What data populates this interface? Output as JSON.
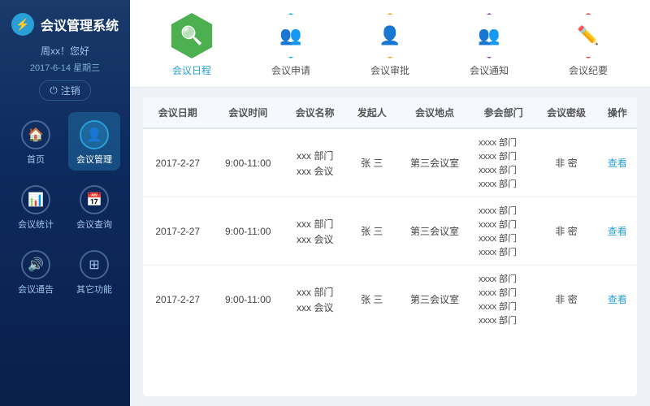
{
  "sidebar": {
    "logo_label": "会议管理系统",
    "user_greeting": "周xx！您好",
    "date": "2017-6-14  星期三",
    "logout_label": "注销",
    "nav_items": [
      {
        "id": "home",
        "label": "首页",
        "icon": "🏠",
        "active": false
      },
      {
        "id": "meeting-mgmt",
        "label": "会议管理",
        "icon": "👤",
        "active": true
      },
      {
        "id": "meeting-stats",
        "label": "会议统计",
        "icon": "📊",
        "active": false
      },
      {
        "id": "meeting-query",
        "label": "会议查询",
        "icon": "📅",
        "active": false
      },
      {
        "id": "announcement",
        "label": "会议通告",
        "icon": "🔊",
        "active": false
      },
      {
        "id": "other",
        "label": "其它功能",
        "icon": "⊞",
        "active": false
      }
    ]
  },
  "top_icons": [
    {
      "id": "schedule",
      "label": "会议日程",
      "icon": "🔍",
      "color": "#4caf50",
      "active": true
    },
    {
      "id": "apply",
      "label": "会议申请",
      "icon": "👥",
      "color": "#29b6d8",
      "active": false
    },
    {
      "id": "review",
      "label": "会议审批",
      "icon": "👤",
      "color": "#f5a623",
      "active": false
    },
    {
      "id": "notify",
      "label": "会议通知",
      "icon": "👥",
      "color": "#9b59b6",
      "active": false
    },
    {
      "id": "minutes",
      "label": "会议纪要",
      "icon": "✏️",
      "color": "#e74c3c",
      "active": false
    }
  ],
  "table": {
    "headers": [
      "会议日期",
      "会议时间",
      "会议名称",
      "发起人",
      "会议地点",
      "参会部门",
      "会议密级",
      "操作"
    ],
    "rows": [
      {
        "date": "2017-2-27",
        "time": "9:00-11:00",
        "name_line1": "xxx 部门",
        "name_line2": "xxx 会议",
        "initiator": "张 三",
        "location": "第三会议室",
        "departments": [
          "xxxx 部门",
          "xxxx 部门",
          "xxxx 部门",
          "xxxx 部门"
        ],
        "security": "非 密",
        "action": "查看"
      },
      {
        "date": "2017-2-27",
        "time": "9:00-11:00",
        "name_line1": "xxx 部门",
        "name_line2": "xxx 会议",
        "initiator": "张 三",
        "location": "第三会议室",
        "departments": [
          "xxxx 部门",
          "xxxx 部门",
          "xxxx 部门",
          "xxxx 部门"
        ],
        "security": "非 密",
        "action": "查看"
      },
      {
        "date": "2017-2-27",
        "time": "9:00-11:00",
        "name_line1": "xxx 部门",
        "name_line2": "xxx 会议",
        "initiator": "张 三",
        "location": "第三会议室",
        "departments": [
          "xxxx 部门",
          "xxxx 部门",
          "xxxx 部门",
          "xxxx 部门"
        ],
        "security": "非 密",
        "action": "查看"
      }
    ]
  },
  "colors": {
    "active_nav_bg": "rgba(42,159,214,0.3)",
    "link": "#2a9fd6",
    "header_bg": "#1a3a6b"
  }
}
